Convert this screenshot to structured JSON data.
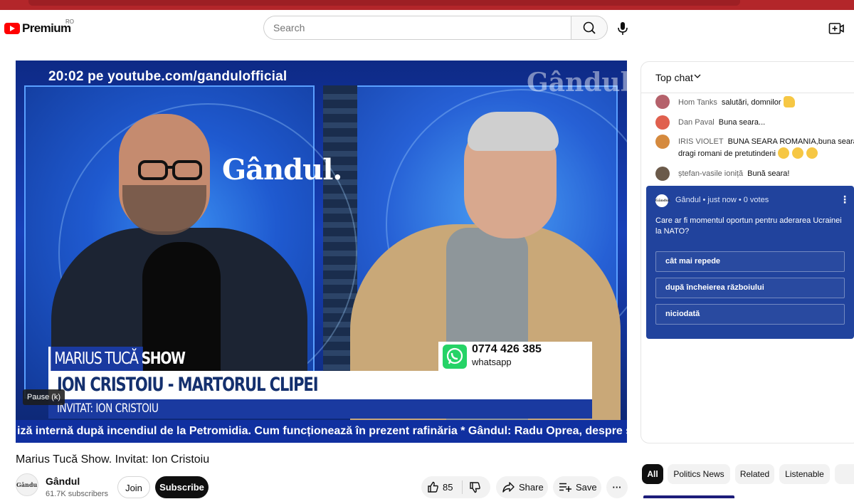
{
  "header": {
    "logo_text": "Premium",
    "country_code": "RO",
    "search_placeholder": "Search",
    "icons": [
      "search-icon",
      "mic-icon",
      "create-icon"
    ]
  },
  "player": {
    "clock_overlay": "20:02 pe youtube.com/gandulofficial",
    "watermark": "Gândul.",
    "watermark_short": "Gândul",
    "show_name_regular": "MARIUS TUCĂ ",
    "show_name_bold": "SHOW",
    "segment_title": "ION CRISTOIU - MARTORUL CLIPEI",
    "guest_line": "INVITAT: ION CRISTOIU",
    "phone_number": "0774 426 385",
    "phone_label": "whatsapp",
    "ticker": "iză internă după incendiul de la Petromidia. Cum funcționează în prezent rafinăria * Gândul: Radu Oprea, despre s",
    "pause_tooltip": "Pause (k)"
  },
  "video": {
    "title": "Marius Tucă Show. Invitat: Ion Cristoiu",
    "channel_name": "Gândul",
    "channel_avatar_text": "Gândul.",
    "subscribers": "61.7K subscribers",
    "join_label": "Join",
    "subscribe_label": "Subscribe",
    "like_count": "85",
    "share_label": "Share",
    "save_label": "Save",
    "more_label": "···"
  },
  "chat": {
    "header_title": "Top chat",
    "messages": [
      {
        "author": "Hom Tanks",
        "text": "salutări, domnilor",
        "avatar_color": "#b5616b",
        "emojis": 1
      },
      {
        "author": "Dan Paval",
        "text": "Buna seara...",
        "avatar_color": "#e0604e",
        "emojis": 0
      },
      {
        "author": "IRIS VIOLET",
        "text": "BUNA SEARA ROMANIA,buna seara dragi romani de pretutindeni",
        "avatar_color": "#d58a3e",
        "emojis": 3
      },
      {
        "author": "ștefan-vasile ioniță",
        "text": "Bună seara!",
        "avatar_color": "#6b5a4a",
        "emojis": 0
      }
    ],
    "poll": {
      "author_meta": "Gândul • just now • 0 votes",
      "avatar_text": "Gândul.",
      "question": "Care ar fi momentul oportun pentru aderarea Ucrainei la NATO?",
      "options": [
        "cât mai repede",
        "după încheierea războiului",
        "niciodată"
      ]
    }
  },
  "chips": [
    "All",
    "Politics News",
    "Related",
    "Listenable"
  ],
  "colors": {
    "brand_red": "#ff0000",
    "poll_bg": "#21439d",
    "lower_third_blue": "#1a3aa0",
    "whatsapp_green": "#25d366"
  }
}
